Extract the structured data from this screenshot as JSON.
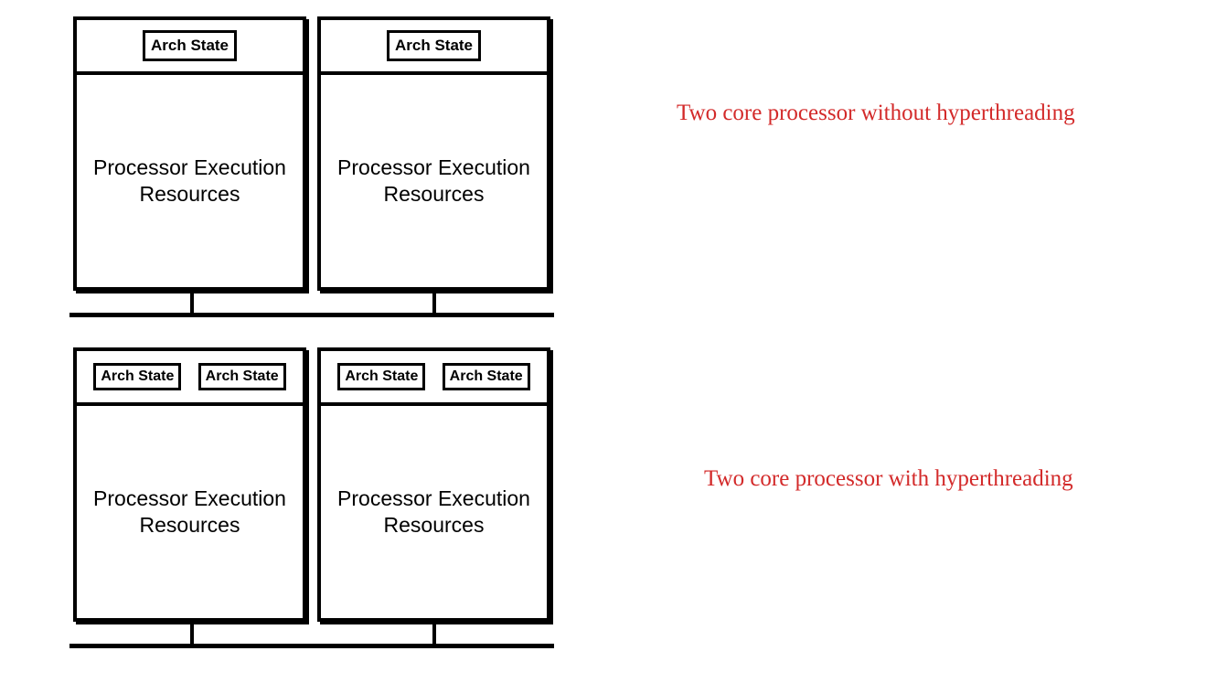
{
  "diagrams": {
    "top": {
      "annotation": "Two core processor without hyperthreading",
      "processors": [
        {
          "arch_states": [
            "Arch State"
          ],
          "exec": "Processor Execution Resources"
        },
        {
          "arch_states": [
            "Arch State"
          ],
          "exec": "Processor Execution Resources"
        }
      ]
    },
    "bottom": {
      "annotation": "Two core processor with hyperthreading",
      "processors": [
        {
          "arch_states": [
            "Arch State",
            "Arch State"
          ],
          "exec": "Processor Execution Resources"
        },
        {
          "arch_states": [
            "Arch State",
            "Arch State"
          ],
          "exec": "Processor Execution Resources"
        }
      ]
    }
  }
}
